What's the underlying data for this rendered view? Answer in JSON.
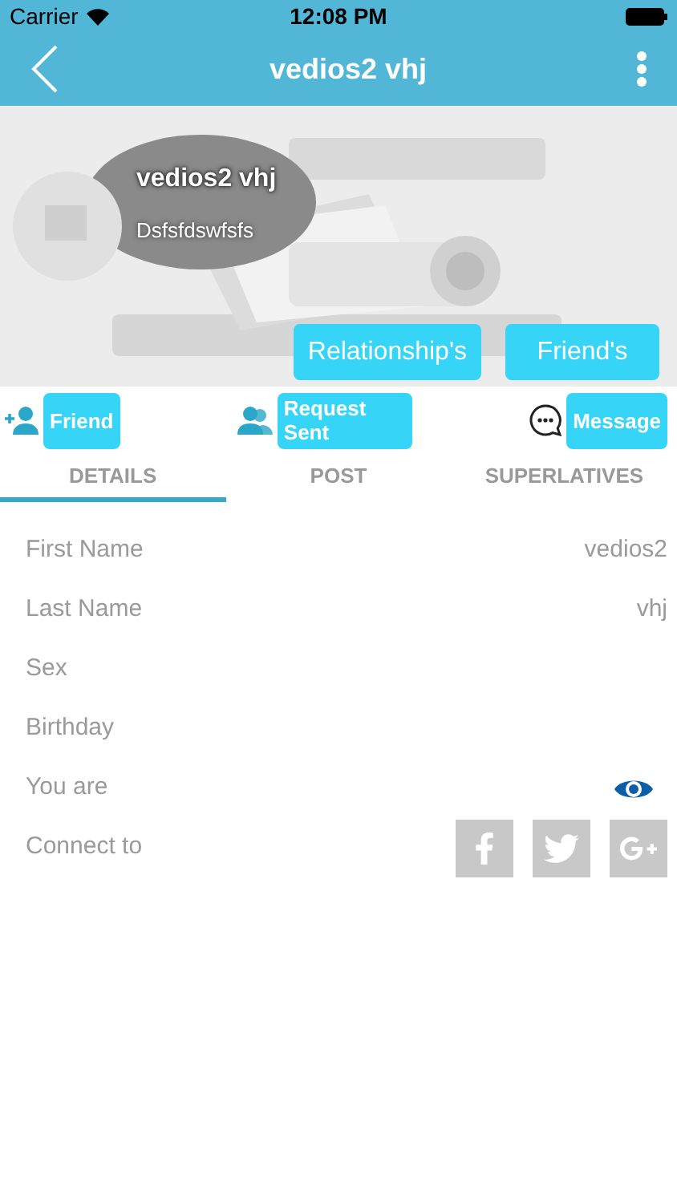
{
  "status_bar": {
    "carrier": "Carrier",
    "time": "12:08 PM"
  },
  "nav": {
    "title": "vedios2 vhj"
  },
  "profile": {
    "name": "vedios2 vhj",
    "subtitle": "Dsfsfdswfsfs",
    "buttons": [
      "Relationship's",
      "Friend's"
    ]
  },
  "actions": [
    {
      "kind": "add-friend",
      "label": "Friend"
    },
    {
      "kind": "request",
      "label": "Request Sent"
    },
    {
      "kind": "message",
      "label": "Message"
    }
  ],
  "tabs": [
    {
      "label": "DETAILS",
      "selected": true
    },
    {
      "label": "POST",
      "selected": false
    },
    {
      "label": "SUPERLATIVES",
      "selected": false
    }
  ],
  "details": [
    {
      "kind": "text",
      "label": "First Name",
      "value": "vedios2"
    },
    {
      "kind": "text",
      "label": "Last Name",
      "value": "vhj"
    },
    {
      "kind": "text",
      "label": "Sex"
    },
    {
      "kind": "text",
      "label": "Birthday"
    },
    {
      "kind": "visibility",
      "label": "You are"
    },
    {
      "kind": "social",
      "label": "Connect to"
    }
  ]
}
